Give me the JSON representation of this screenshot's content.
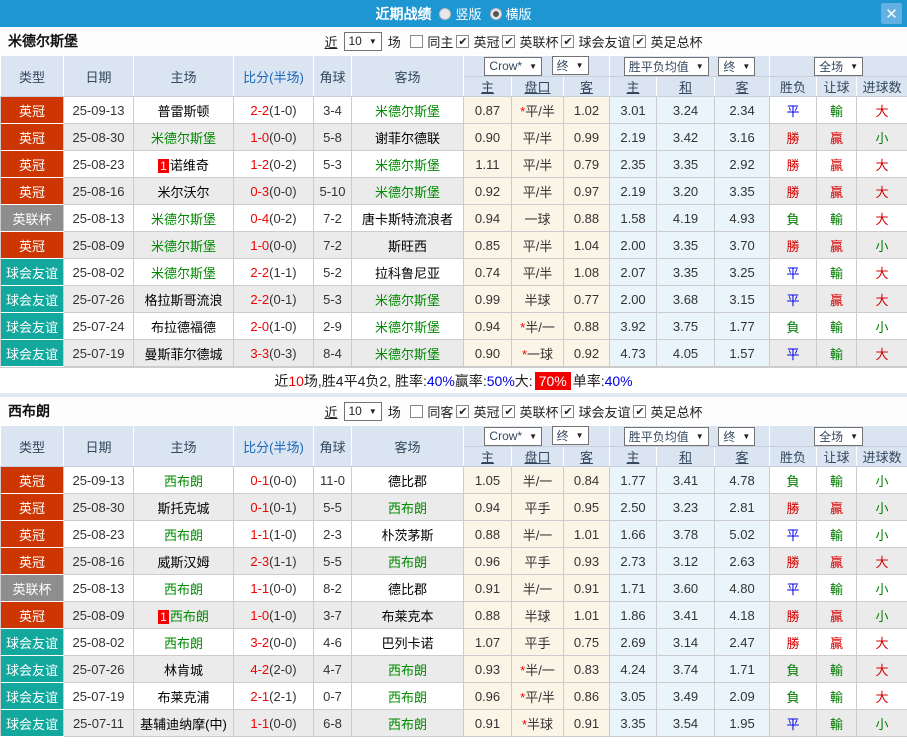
{
  "titlebar": {
    "title": "近期战绩",
    "radio_vertical": "竖版",
    "radio_horizontal": "横版",
    "close_glyph": "✕"
  },
  "colors": {
    "league": {
      "red": "#cd3603",
      "gray": "#8e8e8e",
      "teal": "#13a89e"
    },
    "outcome": {
      "red": "#d50000",
      "blue": "#0000e6",
      "green": "#007d00"
    },
    "titlebar_bg": "#1d96d2",
    "header_bg": "#dbe5f2"
  },
  "columns": {
    "type": "类型",
    "date": "日期",
    "home": "主场",
    "score": "比分(半场)",
    "corner": "角球",
    "away": "客场",
    "sub": [
      "主",
      "盘口",
      "客",
      "主",
      "和",
      "客",
      "胜负",
      "让球",
      "进球数"
    ],
    "selects": {
      "crow": "Crow*",
      "end1": "终",
      "avg": "胜平负均值",
      "end2": "终",
      "full": "全场"
    }
  },
  "sections": [
    {
      "team": "米德尔斯堡",
      "filter": {
        "near": "近",
        "count": "10",
        "games": "场",
        "same": "同主",
        "same_checked": false,
        "leagues": [
          "英冠",
          "英联杯",
          "球会友谊",
          "英足总杯"
        ],
        "check_glyph": "✔"
      },
      "rows": [
        {
          "league": "英冠",
          "league_color": "red",
          "date": "25-09-13",
          "home": "普雷斯顿",
          "home_focus": false,
          "home_mark": "",
          "ft": "2-2",
          "ht": "(1-0)",
          "corner": "3-4",
          "away": "米德尔斯堡",
          "away_focus": true,
          "away_mark": "",
          "h_home": "0.87",
          "handicap": "平/半",
          "handicap_star": true,
          "h_away": "1.02",
          "avg_home": "3.01",
          "avg_draw": "3.24",
          "avg_away": "2.34",
          "res": "平",
          "res_color": "blue",
          "hres": "輸",
          "hres_color": "green",
          "goal": "大",
          "goal_color": "red"
        },
        {
          "league": "英冠",
          "league_color": "red",
          "date": "25-08-30",
          "home": "米德尔斯堡",
          "home_focus": true,
          "home_mark": "",
          "ft": "1-0",
          "ht": "(0-0)",
          "corner": "5-8",
          "away": "谢菲尔德联",
          "away_focus": false,
          "away_mark": "",
          "h_home": "0.90",
          "handicap": "平/半",
          "handicap_star": false,
          "h_away": "0.99",
          "avg_home": "2.19",
          "avg_draw": "3.42",
          "avg_away": "3.16",
          "res": "勝",
          "res_color": "red",
          "hres": "贏",
          "hres_color": "red",
          "goal": "小",
          "goal_color": "green"
        },
        {
          "league": "英冠",
          "league_color": "red",
          "date": "25-08-23",
          "home": "诺维奇",
          "home_focus": false,
          "home_mark": "1",
          "ft": "1-2",
          "ht": "(0-2)",
          "corner": "5-3",
          "away": "米德尔斯堡",
          "away_focus": true,
          "away_mark": "",
          "h_home": "1.11",
          "handicap": "平/半",
          "handicap_star": false,
          "h_away": "0.79",
          "avg_home": "2.35",
          "avg_draw": "3.35",
          "avg_away": "2.92",
          "res": "勝",
          "res_color": "red",
          "hres": "贏",
          "hres_color": "red",
          "goal": "大",
          "goal_color": "red"
        },
        {
          "league": "英冠",
          "league_color": "red",
          "date": "25-08-16",
          "home": "米尔沃尔",
          "home_focus": false,
          "home_mark": "",
          "ft": "0-3",
          "ht": "(0-0)",
          "corner": "5-10",
          "away": "米德尔斯堡",
          "away_focus": true,
          "away_mark": "",
          "h_home": "0.92",
          "handicap": "平/半",
          "handicap_star": false,
          "h_away": "0.97",
          "avg_home": "2.19",
          "avg_draw": "3.20",
          "avg_away": "3.35",
          "res": "勝",
          "res_color": "red",
          "hres": "贏",
          "hres_color": "red",
          "goal": "大",
          "goal_color": "red"
        },
        {
          "league": "英联杯",
          "league_color": "gray",
          "date": "25-08-13",
          "home": "米德尔斯堡",
          "home_focus": true,
          "home_mark": "",
          "ft": "0-4",
          "ht": "(0-2)",
          "corner": "7-2",
          "away": "唐卡斯特流浪者",
          "away_focus": false,
          "away_mark": "",
          "h_home": "0.94",
          "handicap": "一球",
          "handicap_star": false,
          "h_away": "0.88",
          "avg_home": "1.58",
          "avg_draw": "4.19",
          "avg_away": "4.93",
          "res": "負",
          "res_color": "green",
          "hres": "輸",
          "hres_color": "green",
          "goal": "大",
          "goal_color": "red"
        },
        {
          "league": "英冠",
          "league_color": "red",
          "date": "25-08-09",
          "home": "米德尔斯堡",
          "home_focus": true,
          "home_mark": "",
          "ft": "1-0",
          "ht": "(0-0)",
          "corner": "7-2",
          "away": "斯旺西",
          "away_focus": false,
          "away_mark": "",
          "h_home": "0.85",
          "handicap": "平/半",
          "handicap_star": false,
          "h_away": "1.04",
          "avg_home": "2.00",
          "avg_draw": "3.35",
          "avg_away": "3.70",
          "res": "勝",
          "res_color": "red",
          "hres": "贏",
          "hres_color": "red",
          "goal": "小",
          "goal_color": "green"
        },
        {
          "league": "球会友谊",
          "league_color": "teal",
          "date": "25-08-02",
          "home": "米德尔斯堡",
          "home_focus": true,
          "home_mark": "",
          "ft": "2-2",
          "ht": "(1-1)",
          "corner": "5-2",
          "away": "拉科鲁尼亚",
          "away_focus": false,
          "away_mark": "",
          "h_home": "0.74",
          "handicap": "平/半",
          "handicap_star": false,
          "h_away": "1.08",
          "avg_home": "2.07",
          "avg_draw": "3.35",
          "avg_away": "3.25",
          "res": "平",
          "res_color": "blue",
          "hres": "輸",
          "hres_color": "green",
          "goal": "大",
          "goal_color": "red"
        },
        {
          "league": "球会友谊",
          "league_color": "teal",
          "date": "25-07-26",
          "home": "格拉斯哥流浪",
          "home_focus": false,
          "home_mark": "",
          "ft": "2-2",
          "ht": "(0-1)",
          "corner": "5-3",
          "away": "米德尔斯堡",
          "away_focus": true,
          "away_mark": "",
          "h_home": "0.99",
          "handicap": "半球",
          "handicap_star": false,
          "h_away": "0.77",
          "avg_home": "2.00",
          "avg_draw": "3.68",
          "avg_away": "3.15",
          "res": "平",
          "res_color": "blue",
          "hres": "贏",
          "hres_color": "red",
          "goal": "大",
          "goal_color": "red"
        },
        {
          "league": "球会友谊",
          "league_color": "teal",
          "date": "25-07-24",
          "home": "布拉德福德",
          "home_focus": false,
          "home_mark": "",
          "ft": "2-0",
          "ht": "(1-0)",
          "corner": "2-9",
          "away": "米德尔斯堡",
          "away_focus": true,
          "away_mark": "",
          "h_home": "0.94",
          "handicap": "半/一",
          "handicap_star": true,
          "h_away": "0.88",
          "avg_home": "3.92",
          "avg_draw": "3.75",
          "avg_away": "1.77",
          "res": "負",
          "res_color": "green",
          "hres": "輸",
          "hres_color": "green",
          "goal": "小",
          "goal_color": "green"
        },
        {
          "league": "球会友谊",
          "league_color": "teal",
          "date": "25-07-19",
          "home": "曼斯菲尔德城",
          "home_focus": false,
          "home_mark": "",
          "ft": "3-3",
          "ht": "(0-3)",
          "corner": "8-4",
          "away": "米德尔斯堡",
          "away_focus": true,
          "away_mark": "",
          "h_home": "0.90",
          "handicap": "一球",
          "handicap_star": true,
          "h_away": "0.92",
          "avg_home": "4.73",
          "avg_draw": "4.05",
          "avg_away": "1.57",
          "res": "平",
          "res_color": "blue",
          "hres": "輸",
          "hres_color": "green",
          "goal": "大",
          "goal_color": "red"
        }
      ],
      "summary": {
        "p1": "近",
        "count": "10",
        "p2": "场,胜4平4负2, 胜率:",
        "win_rate": "40%",
        "p3": " 赢率:",
        "profit_rate": "50%",
        "p4": " 大:",
        "big_rate": "70%",
        "p5": " 单率:",
        "odd_rate": "40%"
      }
    },
    {
      "team": "西布朗",
      "filter": {
        "near": "近",
        "count": "10",
        "games": "场",
        "same": "同客",
        "same_checked": false,
        "leagues": [
          "英冠",
          "英联杯",
          "球会友谊",
          "英足总杯"
        ],
        "check_glyph": "✔"
      },
      "rows": [
        {
          "league": "英冠",
          "league_color": "red",
          "date": "25-09-13",
          "home": "西布朗",
          "home_focus": true,
          "home_mark": "",
          "ft": "0-1",
          "ht": "(0-0)",
          "corner": "11-0",
          "away": "德比郡",
          "away_focus": false,
          "away_mark": "",
          "h_home": "1.05",
          "handicap": "半/一",
          "handicap_star": false,
          "h_away": "0.84",
          "avg_home": "1.77",
          "avg_draw": "3.41",
          "avg_away": "4.78",
          "res": "負",
          "res_color": "green",
          "hres": "輸",
          "hres_color": "green",
          "goal": "小",
          "goal_color": "green"
        },
        {
          "league": "英冠",
          "league_color": "red",
          "date": "25-08-30",
          "home": "斯托克城",
          "home_focus": false,
          "home_mark": "",
          "ft": "0-1",
          "ht": "(0-1)",
          "corner": "5-5",
          "away": "西布朗",
          "away_focus": true,
          "away_mark": "",
          "h_home": "0.94",
          "handicap": "平手",
          "handicap_star": false,
          "h_away": "0.95",
          "avg_home": "2.50",
          "avg_draw": "3.23",
          "avg_away": "2.81",
          "res": "勝",
          "res_color": "red",
          "hres": "贏",
          "hres_color": "red",
          "goal": "小",
          "goal_color": "green"
        },
        {
          "league": "英冠",
          "league_color": "red",
          "date": "25-08-23",
          "home": "西布朗",
          "home_focus": true,
          "home_mark": "",
          "ft": "1-1",
          "ht": "(1-0)",
          "corner": "2-3",
          "away": "朴茨茅斯",
          "away_focus": false,
          "away_mark": "",
          "h_home": "0.88",
          "handicap": "半/一",
          "handicap_star": false,
          "h_away": "1.01",
          "avg_home": "1.66",
          "avg_draw": "3.78",
          "avg_away": "5.02",
          "res": "平",
          "res_color": "blue",
          "hres": "輸",
          "hres_color": "green",
          "goal": "小",
          "goal_color": "green"
        },
        {
          "league": "英冠",
          "league_color": "red",
          "date": "25-08-16",
          "home": "威斯汉姆",
          "home_focus": false,
          "home_mark": "",
          "ft": "2-3",
          "ht": "(1-1)",
          "corner": "5-5",
          "away": "西布朗",
          "away_focus": true,
          "away_mark": "",
          "h_home": "0.96",
          "handicap": "平手",
          "handicap_star": false,
          "h_away": "0.93",
          "avg_home": "2.73",
          "avg_draw": "3.12",
          "avg_away": "2.63",
          "res": "勝",
          "res_color": "red",
          "hres": "贏",
          "hres_color": "red",
          "goal": "大",
          "goal_color": "red"
        },
        {
          "league": "英联杯",
          "league_color": "gray",
          "date": "25-08-13",
          "home": "西布朗",
          "home_focus": true,
          "home_mark": "",
          "ft": "1-1",
          "ht": "(0-0)",
          "corner": "8-2",
          "away": "德比郡",
          "away_focus": false,
          "away_mark": "",
          "h_home": "0.91",
          "handicap": "半/一",
          "handicap_star": false,
          "h_away": "0.91",
          "avg_home": "1.71",
          "avg_draw": "3.60",
          "avg_away": "4.80",
          "res": "平",
          "res_color": "blue",
          "hres": "輸",
          "hres_color": "green",
          "goal": "小",
          "goal_color": "green"
        },
        {
          "league": "英冠",
          "league_color": "red",
          "date": "25-08-09",
          "home": "西布朗",
          "home_focus": true,
          "home_mark": "1",
          "ft": "1-0",
          "ht": "(1-0)",
          "corner": "3-7",
          "away": "布莱克本",
          "away_focus": false,
          "away_mark": "",
          "h_home": "0.88",
          "handicap": "半球",
          "handicap_star": false,
          "h_away": "1.01",
          "avg_home": "1.86",
          "avg_draw": "3.41",
          "avg_away": "4.18",
          "res": "勝",
          "res_color": "red",
          "hres": "贏",
          "hres_color": "red",
          "goal": "小",
          "goal_color": "green"
        },
        {
          "league": "球会友谊",
          "league_color": "teal",
          "date": "25-08-02",
          "home": "西布朗",
          "home_focus": true,
          "home_mark": "",
          "ft": "3-2",
          "ht": "(0-0)",
          "corner": "4-6",
          "away": "巴列卡诺",
          "away_focus": false,
          "away_mark": "",
          "h_home": "1.07",
          "handicap": "平手",
          "handicap_star": false,
          "h_away": "0.75",
          "avg_home": "2.69",
          "avg_draw": "3.14",
          "avg_away": "2.47",
          "res": "勝",
          "res_color": "red",
          "hres": "贏",
          "hres_color": "red",
          "goal": "大",
          "goal_color": "red"
        },
        {
          "league": "球会友谊",
          "league_color": "teal",
          "date": "25-07-26",
          "home": "林肯城",
          "home_focus": false,
          "home_mark": "",
          "ft": "4-2",
          "ht": "(2-0)",
          "corner": "4-7",
          "away": "西布朗",
          "away_focus": true,
          "away_mark": "",
          "h_home": "0.93",
          "handicap": "半/一",
          "handicap_star": true,
          "h_away": "0.83",
          "avg_home": "4.24",
          "avg_draw": "3.74",
          "avg_away": "1.71",
          "res": "負",
          "res_color": "green",
          "hres": "輸",
          "hres_color": "green",
          "goal": "大",
          "goal_color": "red"
        },
        {
          "league": "球会友谊",
          "league_color": "teal",
          "date": "25-07-19",
          "home": "布莱克浦",
          "home_focus": false,
          "home_mark": "",
          "ft": "2-1",
          "ht": "(2-1)",
          "corner": "0-7",
          "away": "西布朗",
          "away_focus": true,
          "away_mark": "",
          "h_home": "0.96",
          "handicap": "平/半",
          "handicap_star": true,
          "h_away": "0.86",
          "avg_home": "3.05",
          "avg_draw": "3.49",
          "avg_away": "2.09",
          "res": "負",
          "res_color": "green",
          "hres": "輸",
          "hres_color": "green",
          "goal": "大",
          "goal_color": "red"
        },
        {
          "league": "球会友谊",
          "league_color": "teal",
          "date": "25-07-11",
          "home": "基辅迪纳摩(中)",
          "home_focus": false,
          "home_mark": "",
          "ft": "1-1",
          "ht": "(0-0)",
          "corner": "6-8",
          "away": "西布朗",
          "away_focus": true,
          "away_mark": "",
          "h_home": "0.91",
          "handicap": "半球",
          "handicap_star": true,
          "h_away": "0.91",
          "avg_home": "3.35",
          "avg_draw": "3.54",
          "avg_away": "1.95",
          "res": "平",
          "res_color": "blue",
          "hres": "輸",
          "hres_color": "green",
          "goal": "小",
          "goal_color": "green"
        }
      ],
      "summary": null
    }
  ]
}
